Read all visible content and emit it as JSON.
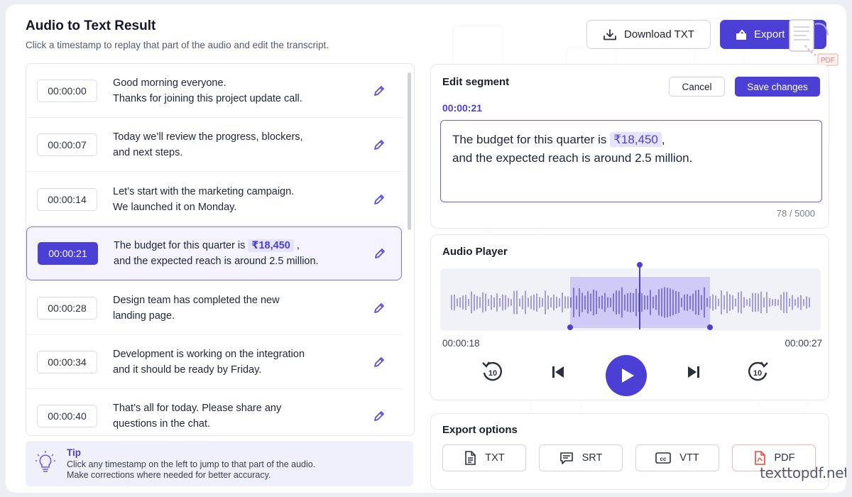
{
  "header": {
    "title": "Audio to Text Result",
    "subtitle": "Click a timestamp to replay that part of the audio and edit the transcript.",
    "download_label": "Download TXT",
    "export_label": "Export",
    "pdf_badge": "PDF"
  },
  "segments": [
    {
      "time": "00:00:00",
      "line1": "Good morning everyone.",
      "line2": "Thanks for joining this project update call."
    },
    {
      "time": "00:00:07",
      "line1": "Today we’ll review the progress, blockers,",
      "line2": "and next steps."
    },
    {
      "time": "00:00:14",
      "line1": "Let’s start with the marketing campaign.",
      "line2": "We launched it on Monday."
    },
    {
      "time": "00:00:21",
      "line1_pre": "The budget for this quarter is ",
      "line1_hl": "₹18,450",
      "line1_post": " ,",
      "line2": "and the expected reach is around 2.5 million."
    },
    {
      "time": "00:00:28",
      "line1": "Design team has completed the new",
      "line2": "landing page."
    },
    {
      "time": "00:00:34",
      "line1": "Development is working on the integration",
      "line2": "and it should be ready by Friday."
    },
    {
      "time": "00:00:40",
      "line1": "That’s all for today. Please share any",
      "line2": "questions in the chat."
    }
  ],
  "tip": {
    "title": "Tip",
    "line1": "Click any timestamp on the left to jump to that part of the audio.",
    "line2": "Make corrections where needed for better accuracy."
  },
  "editor": {
    "title": "Edit segment",
    "cancel_label": "Cancel",
    "save_label": "Save changes",
    "timestamp": "00:00:21",
    "text_pre": "The budget for this quarter is ",
    "text_hl": "₹18,450",
    "text_post": ",",
    "text_line2": "and the expected reach is around 2.5 million.",
    "counter": "78 / 5000"
  },
  "player": {
    "title": "Audio Player",
    "start_time": "00:00:18",
    "end_time": "00:00:27",
    "rewind_label": "10",
    "forward_label": "10"
  },
  "export_options": {
    "title": "Export options",
    "formats": [
      "TXT",
      "SRT",
      "VTT",
      "PDF"
    ]
  },
  "watermark": "texttopdf.net",
  "colors": {
    "accent": "#4b3fd6",
    "accent_light": "#e6e3ff",
    "pdf_red": "#e2483d"
  }
}
